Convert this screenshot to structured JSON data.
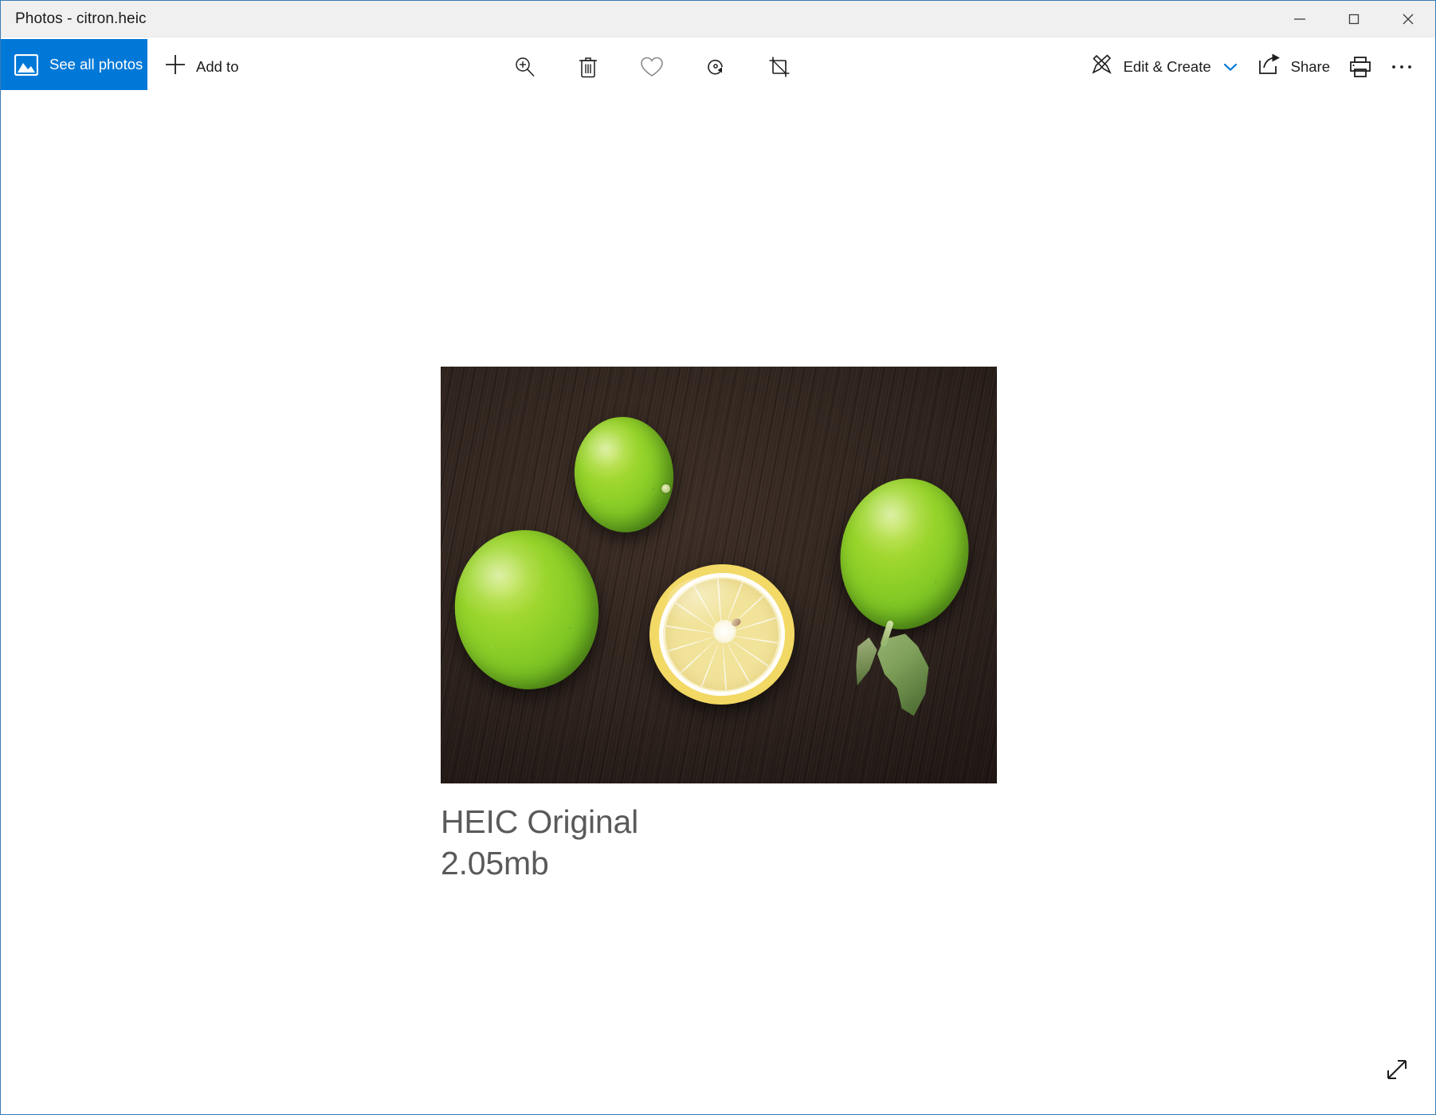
{
  "window": {
    "title": "Photos - citron.heic",
    "accent_color": "#0078d7",
    "titlebar_bg": "#f0f0f0",
    "border_color": "#3a7cb5",
    "controls": {
      "minimize": "minimize-icon",
      "maximize": "maximize-icon",
      "close": "close-icon"
    }
  },
  "toolbar": {
    "see_all_photos_label": "See all photos",
    "see_all_photos_icon": "photos-icon",
    "add_to_label": "Add to",
    "add_to_icon": "plus-icon",
    "center_actions": [
      {
        "name": "zoom",
        "icon": "zoom-in-icon"
      },
      {
        "name": "delete",
        "icon": "trash-icon"
      },
      {
        "name": "favorite",
        "icon": "heart-icon"
      },
      {
        "name": "rotate",
        "icon": "rotate-icon"
      },
      {
        "name": "crop",
        "icon": "crop-icon"
      }
    ],
    "edit_create_label": "Edit & Create",
    "edit_create_icon": "edit-create-icon",
    "edit_create_chevron": "chevron-down-icon",
    "share_label": "Share",
    "share_icon": "share-icon",
    "print_icon": "printer-icon",
    "more_icon": "more-ellipsis-icon"
  },
  "viewer": {
    "caption_line1": "HEIC Original",
    "caption_line2": "2.05mb",
    "caption_color": "#5a5a5a",
    "expand_icon": "expand-diagonal-icon",
    "photo": {
      "alt": "Three whole green limes and one halved lemon on a dark brown wooden surface",
      "background": "dark brown wood grain",
      "subjects": [
        {
          "name": "lime-top",
          "type": "whole lime",
          "position": "top-center"
        },
        {
          "name": "lime-left",
          "type": "whole lime",
          "position": "left"
        },
        {
          "name": "lime-right",
          "type": "whole lime with stem and leaf",
          "position": "right"
        },
        {
          "name": "lemon-half",
          "type": "halved lemon",
          "position": "bottom-center"
        }
      ]
    }
  }
}
